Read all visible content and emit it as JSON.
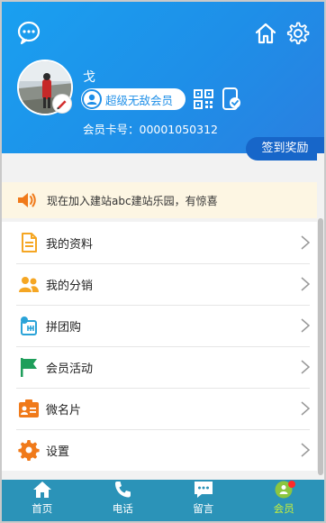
{
  "header": {
    "username": "戈",
    "member_level": "超级无敌会员",
    "card_number": "会员卡号：00001050312",
    "checkin_label": "签到奖励",
    "icons": {
      "chat": "chat-bubble-icon",
      "home": "home-icon",
      "settings": "gear-icon",
      "qr": "qr-code-icon",
      "phone": "phone-verified-icon",
      "avatar_edit": "pencil-icon"
    }
  },
  "notice": {
    "text": "现在加入建站abc建站乐园，有惊喜",
    "icon": "speaker-icon"
  },
  "menu": {
    "items": [
      {
        "label": "我的资料",
        "icon": "document-icon",
        "color": "#f5a623"
      },
      {
        "label": "我的分销",
        "icon": "people-icon",
        "color": "#f5a623"
      },
      {
        "label": "拼团购",
        "icon": "group-buy-icon",
        "color": "#2aa3d8"
      },
      {
        "label": "会员活动",
        "icon": "flag-icon",
        "color": "#1e9e5a"
      },
      {
        "label": "微名片",
        "icon": "business-card-icon",
        "color": "#f07a1a"
      },
      {
        "label": "设置",
        "icon": "gear-icon",
        "color": "#f07a1a"
      }
    ]
  },
  "nav": {
    "items": [
      {
        "label": "首页",
        "icon": "home-icon"
      },
      {
        "label": "电话",
        "icon": "phone-icon"
      },
      {
        "label": "留言",
        "icon": "message-icon"
      },
      {
        "label": "会员",
        "icon": "member-icon"
      }
    ],
    "active_index": 3
  },
  "colors": {
    "header": "#1e8fe8",
    "nav": "#2b93b8",
    "nav_active": "#c7ef3a",
    "checkin": "#1766c9",
    "notice_bg": "#fdf6e3"
  }
}
